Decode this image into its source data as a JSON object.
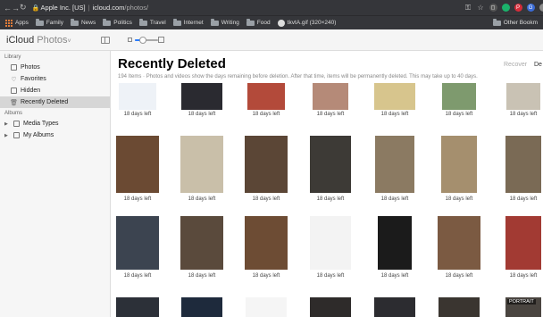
{
  "browser": {
    "url_host": "Apple Inc. [US]",
    "url_sep": "|",
    "url_domain": "icloud.com",
    "url_path": "/photos/",
    "bookmarks": [
      "Apps",
      "Family",
      "News",
      "Politics",
      "Travel",
      "Internet",
      "Writing",
      "Food",
      "tkvtA.gif (320×240)"
    ],
    "other_bookmarks": "Other Bookm"
  },
  "header": {
    "brand": "iCloud",
    "app": "Photos",
    "chevron": "˅"
  },
  "sidebar": {
    "library_title": "Library",
    "library_items": [
      {
        "label": "Photos",
        "icon": "photos-icon"
      },
      {
        "label": "Favorites",
        "icon": "heart-icon"
      },
      {
        "label": "Hidden",
        "icon": "hidden-icon"
      },
      {
        "label": "Recently Deleted",
        "icon": "trash-icon"
      }
    ],
    "albums_title": "Albums",
    "album_items": [
      {
        "label": "Media Types",
        "icon": "folder-icon"
      },
      {
        "label": "My Albums",
        "icon": "folder-icon"
      }
    ]
  },
  "main": {
    "title": "Recently Deleted",
    "count": "194 Items",
    "separator": "·",
    "description": "Photos and videos show the days remaining before deletion. After that time, items will be permanently deleted. This may take up to 40 days.",
    "recover_label": "Recover",
    "delete_label": "De",
    "portrait_badge": "PORTRAIT",
    "caption": "18 days left"
  },
  "zoom": {
    "level": 0.35
  },
  "colors": {
    "chrome_bg": "#35363a",
    "accent": "#2b7cff",
    "selected": "#d6d6d6"
  }
}
